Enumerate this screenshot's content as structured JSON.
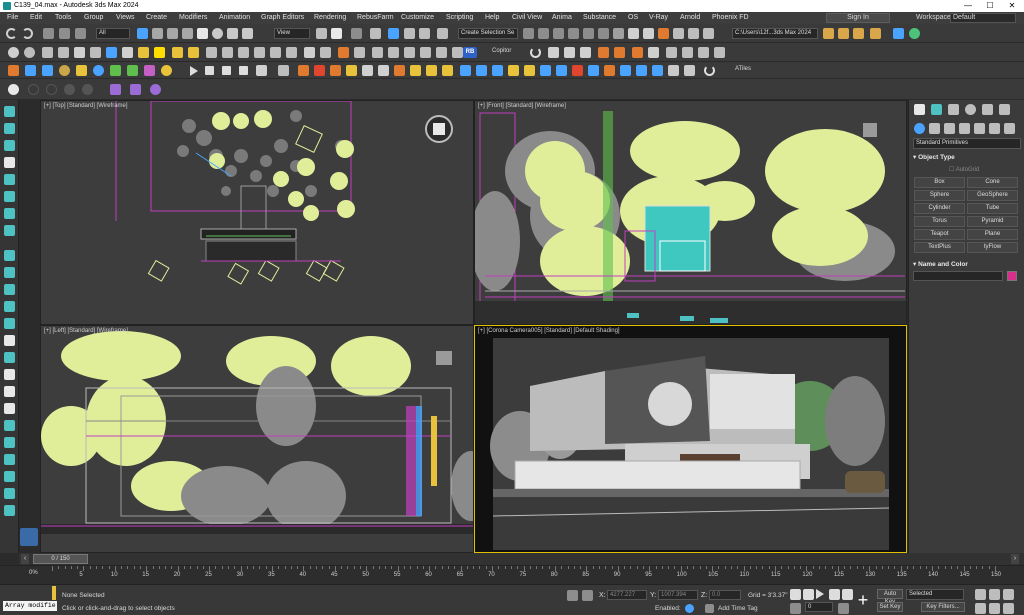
{
  "titlebar": {
    "title": "C139_04.max - Autodesk 3ds Max 2024",
    "minimize": "—",
    "maximize": "☐",
    "close": "✕"
  },
  "menu": [
    "File",
    "Edit",
    "Tools",
    "Group",
    "Views",
    "Create",
    "Modifiers",
    "Animation",
    "Graph Editors",
    "Rendering",
    "RebusFarm",
    "Customize",
    "Scripting",
    "Help",
    "Civil View",
    "Anima",
    "Substance",
    "OS",
    "V-Ray",
    "Arnold",
    "Phoenix FD"
  ],
  "signin": "Sign In",
  "workspaces": {
    "label": "Workspaces:",
    "value": "Default"
  },
  "toolbar": {
    "filter": "All",
    "refcoord": "View",
    "selection_set": "Create Selection Se",
    "copitor": "Copitor",
    "path": "C:\\Users\\12f...3ds Max 2024",
    "atiles": "ATiles"
  },
  "viewports": {
    "top": "[+] [Top] [Standard] [Wireframe]",
    "front": "[+] [Front] [Standard] [Wireframe]",
    "left": "[+] [Left] [Standard] [Wireframe]",
    "camera": "[+] [Corona Camera005] [Standard] [Default Shading]"
  },
  "command_panel": {
    "dropdown": "Standard Primitives",
    "object_type": "Object Type",
    "autogrid": "AutoGrid",
    "primitives": [
      "Box",
      "Cone",
      "Sphere",
      "GeoSphere",
      "Cylinder",
      "Tube",
      "Torus",
      "Pyramid",
      "Teapot",
      "Plane",
      "TextPlus",
      "tyFlow"
    ],
    "name_color": "Name and Color",
    "object_color": "#d8308a"
  },
  "timeline": {
    "frame": "0 / 150",
    "ticks": [
      "5",
      "10",
      "15",
      "20",
      "25",
      "30",
      "35",
      "40",
      "45",
      "50",
      "55",
      "60",
      "65",
      "70",
      "75",
      "80",
      "85",
      "90",
      "95",
      "100",
      "105",
      "110",
      "115",
      "120",
      "125",
      "130",
      "135",
      "140",
      "145",
      "150"
    ],
    "percent_label": "0%"
  },
  "status": {
    "maxscript": "Array modifie",
    "none_selected": "None Selected",
    "prompt": "Click or click-and-drag to select objects",
    "x_label": "X:",
    "x_value": "4277.227",
    "y_label": "Y:",
    "y_value": "1007.394",
    "z_label": "Z:",
    "z_value": "0.0",
    "grid": "Grid = 3'3.37\"",
    "enabled": "Enabled:",
    "add_time_tag": "Add Time Tag",
    "auto_key": "Auto Key",
    "set_key": "Set Key",
    "selected": "Selected",
    "key_filters": "Key Filters...",
    "current_frame": "0"
  }
}
